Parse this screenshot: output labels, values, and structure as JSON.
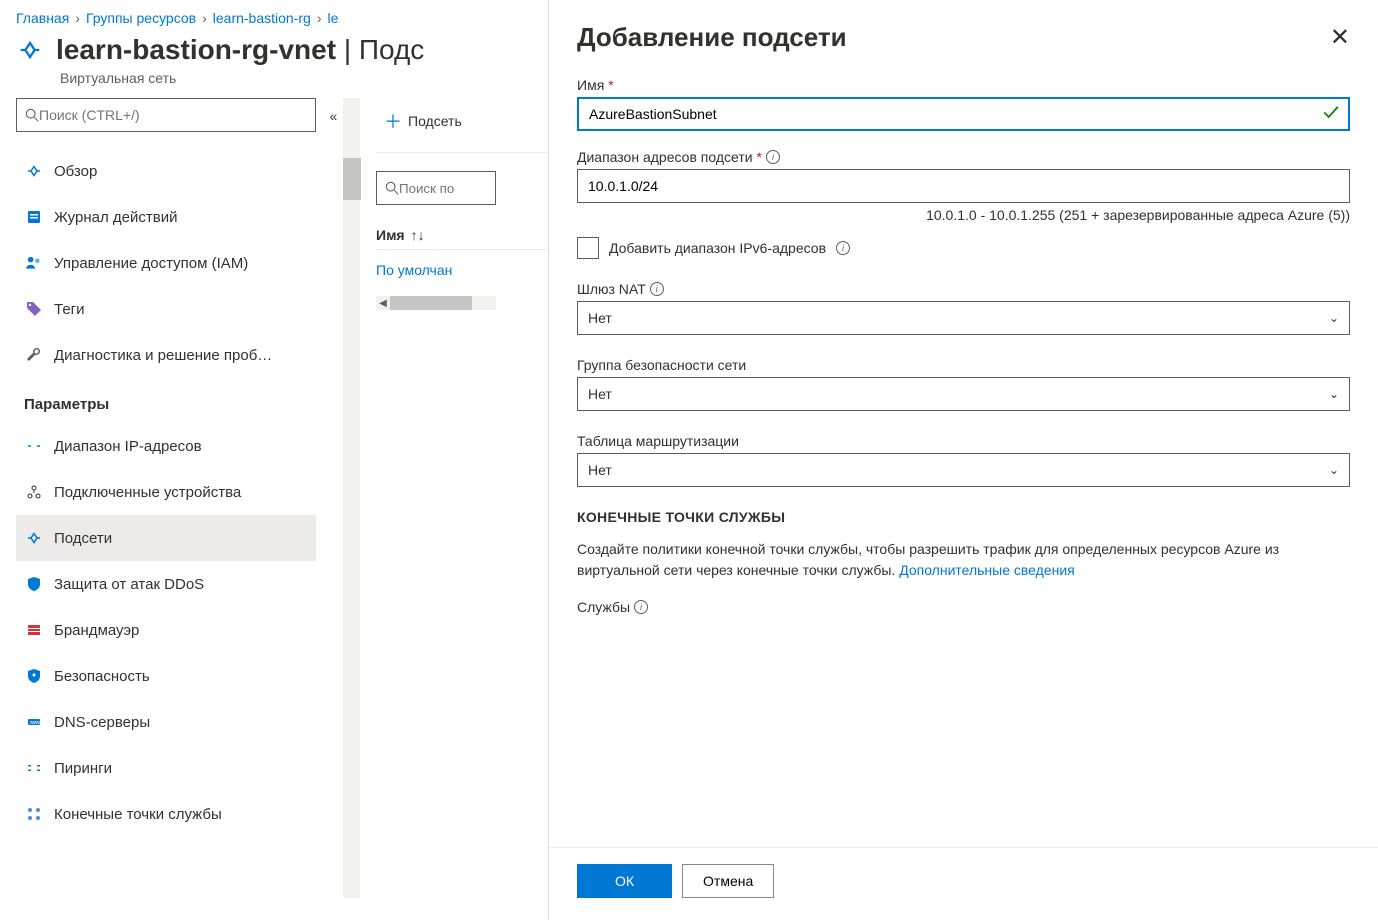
{
  "breadcrumb": {
    "home": "Главная",
    "groups": "Группы ресурсов",
    "rg": "learn-bastion-rg",
    "rgvnet": "le"
  },
  "header": {
    "title_main": "learn-bastion-rg-vnet",
    "title_suffix": "Подс",
    "subtitle": "Виртуальная сеть"
  },
  "sidebar": {
    "search_placeholder": "Поиск (CTRL+/)",
    "items": [
      {
        "label": "Обзор"
      },
      {
        "label": "Журнал действий"
      },
      {
        "label": "Управление доступом (IAM)"
      },
      {
        "label": "Теги"
      },
      {
        "label": "Диагностика и решение проб…"
      }
    ],
    "section": "Параметры",
    "params": [
      {
        "label": "Диапазон IP-адресов"
      },
      {
        "label": "Подключенные устройства"
      },
      {
        "label": "Подсети"
      },
      {
        "label": "Защита от атак DDoS"
      },
      {
        "label": "Брандмауэр"
      },
      {
        "label": "Безопасность"
      },
      {
        "label": "DNS-серверы"
      },
      {
        "label": "Пиринги"
      },
      {
        "label": "Конечные точки службы"
      }
    ]
  },
  "toolbar": {
    "subnet": "Подсеть"
  },
  "main": {
    "search_placeholder": "Поиск по",
    "col_name": "Имя",
    "row_default": "По умолчан"
  },
  "panel": {
    "title": "Добавление подсети",
    "name_label": "Имя",
    "name_value": "AzureBastionSubnet",
    "range_label": "Диапазон адресов подсети",
    "range_value": "10.0.1.0/24",
    "range_helper": "10.0.1.0 - 10.0.1.255 (251 + зарезервированные адреса Azure (5))",
    "ipv6_label": "Добавить диапазон IPv6-адресов",
    "nat_label": "Шлюз NAT",
    "nat_value": "Нет",
    "nsg_label": "Группа безопасности сети",
    "nsg_value": "Нет",
    "route_label": "Таблица маршрутизации",
    "route_value": "Нет",
    "endpoints_title": "КОНЕЧНЫЕ ТОЧКИ СЛУЖБЫ",
    "endpoints_desc": "Создайте политики конечной точки службы, чтобы разрешить трафик для определенных ресурсов Azure из виртуальной сети через конечные точки службы. ",
    "endpoints_link": "Дополнительные сведения",
    "services_label": "Службы",
    "ok": "ОК",
    "cancel": "Отмена"
  }
}
